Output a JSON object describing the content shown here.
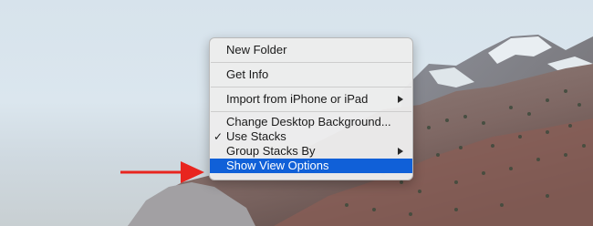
{
  "context_menu": {
    "items": [
      {
        "label": "New Folder"
      },
      {
        "label": "Get Info"
      },
      {
        "label": "Import from iPhone or iPad"
      },
      {
        "label": "Change Desktop Background..."
      },
      {
        "label": "Use Stacks",
        "checked": true
      },
      {
        "label": "Group Stacks By"
      },
      {
        "label": "Show View Options",
        "highlighted": true
      }
    ],
    "highlight_color": "#1060d8"
  },
  "annotation": {
    "arrow_color": "#e8251f"
  }
}
